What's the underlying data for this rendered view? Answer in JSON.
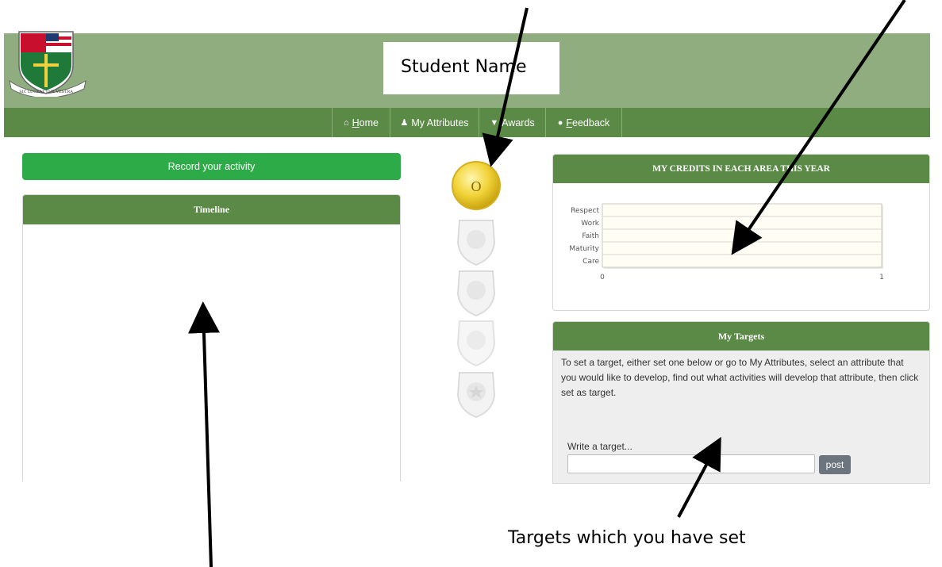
{
  "header": {
    "student_name": "Student Name",
    "crest_motto": "SIC LUCEAT LUX VESTRA"
  },
  "nav": [
    {
      "icon": "home-icon",
      "glyph": "⌂",
      "label_first": "H",
      "label_rest": "ome"
    },
    {
      "icon": "user-icon",
      "glyph": "♟",
      "label_first": "",
      "label_rest": "My Attributes"
    },
    {
      "icon": "shield-icon",
      "glyph": "▼",
      "label_first": "",
      "label_rest": "Awards"
    },
    {
      "icon": "comment-icon",
      "glyph": "●",
      "label_first": "F",
      "label_rest": "eedback"
    }
  ],
  "left": {
    "record_button": "Record your activity",
    "timeline_title": "Timeline"
  },
  "badges": {
    "gold_letter": "O"
  },
  "credits": {
    "title": "MY CREDITS IN EACH AREA THIS YEAR"
  },
  "chart_data": {
    "type": "bar",
    "orientation": "horizontal",
    "title": "MY CREDITS IN EACH AREA THIS YEAR",
    "categories": [
      "Respect",
      "Work",
      "Faith",
      "Maturity",
      "Care"
    ],
    "values": [
      0,
      0,
      0,
      0,
      0
    ],
    "xlim": [
      0,
      1
    ],
    "x_ticks": [
      "0",
      "1"
    ],
    "grid": true,
    "colors": {
      "plot_bg": "#fffdf4",
      "grid": "#d7d7cf"
    }
  },
  "targets": {
    "title": "My Targets",
    "instructions": "To set a target, either set one below or go to My Attributes, select an attribute that you would like to develop, find out what activities will develop that attribute, then click set as target.",
    "write_label": "Write a target...",
    "input_value": "",
    "post_button": "post"
  },
  "annotation": {
    "caption": "Targets which you have set"
  },
  "colors": {
    "header_green": "#8fad7e",
    "nav_green": "#5a8a46",
    "button_green": "#2cab48",
    "gold": "#f2d43a"
  }
}
